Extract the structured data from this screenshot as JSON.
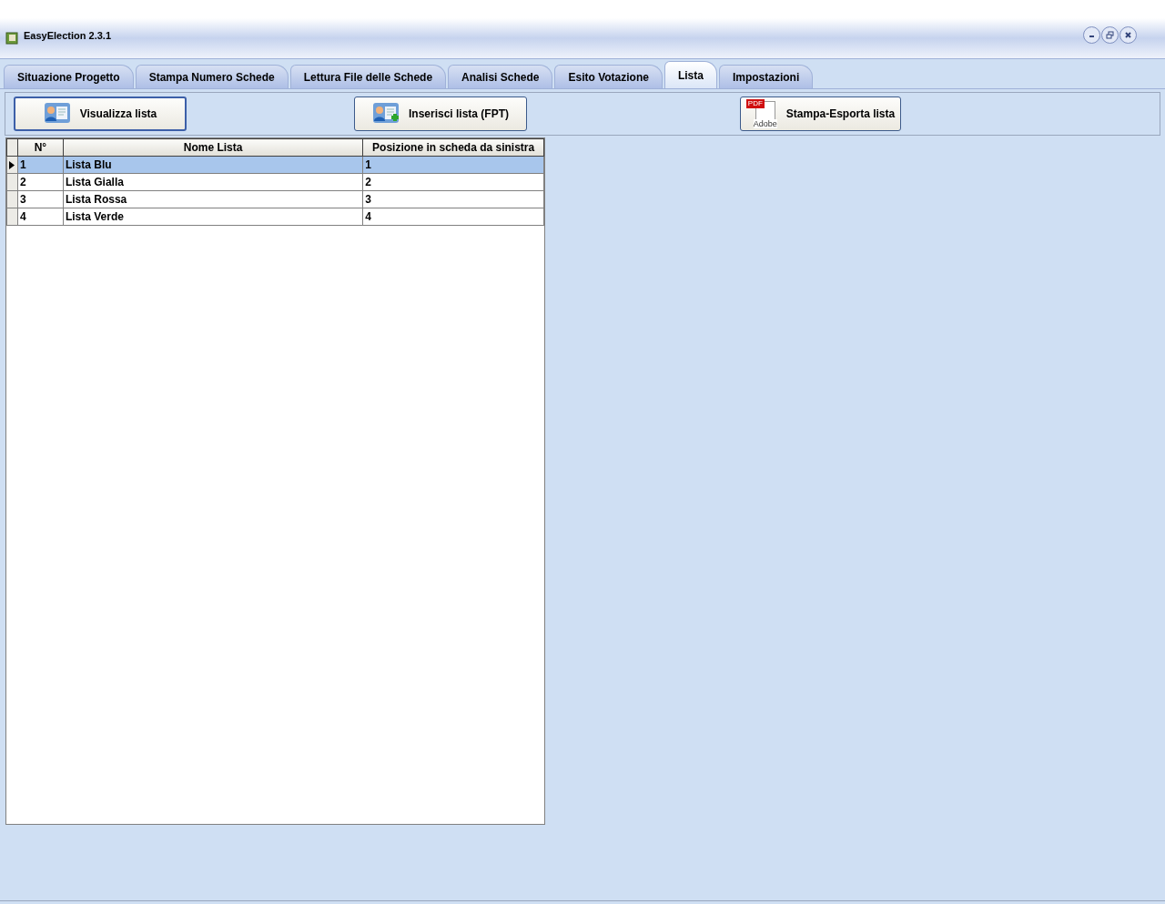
{
  "window": {
    "title": "EasyElection 2.3.1"
  },
  "tabs": [
    {
      "label": "Situazione Progetto",
      "selected": false
    },
    {
      "label": "Stampa Numero Schede",
      "selected": false
    },
    {
      "label": "Lettura File delle Schede",
      "selected": false
    },
    {
      "label": "Analisi Schede",
      "selected": false
    },
    {
      "label": "Esito Votazione",
      "selected": false
    },
    {
      "label": "Lista",
      "selected": true
    },
    {
      "label": "Impostazioni",
      "selected": false
    }
  ],
  "toolbar": [
    {
      "label": "Visualizza lista",
      "kind": "view",
      "focused": true
    },
    {
      "label": "Inserisci lista (FPT)",
      "kind": "add",
      "focused": false
    },
    {
      "label": "Stampa-Esporta lista",
      "kind": "pdf",
      "focused": false,
      "icon_texts": [
        "PDF",
        "Adobe"
      ]
    }
  ],
  "table": {
    "columns": [
      "N°",
      "Nome Lista",
      "Posizione in scheda da sinistra"
    ],
    "rows": [
      {
        "cells": [
          "1",
          "Lista Blu",
          "1"
        ],
        "selected": true
      },
      {
        "cells": [
          "2",
          "Lista Gialla",
          "2"
        ],
        "selected": false
      },
      {
        "cells": [
          "3",
          "Lista Rossa",
          "3"
        ],
        "selected": false
      },
      {
        "cells": [
          "4",
          "Lista Verde",
          "4"
        ],
        "selected": false
      }
    ]
  }
}
